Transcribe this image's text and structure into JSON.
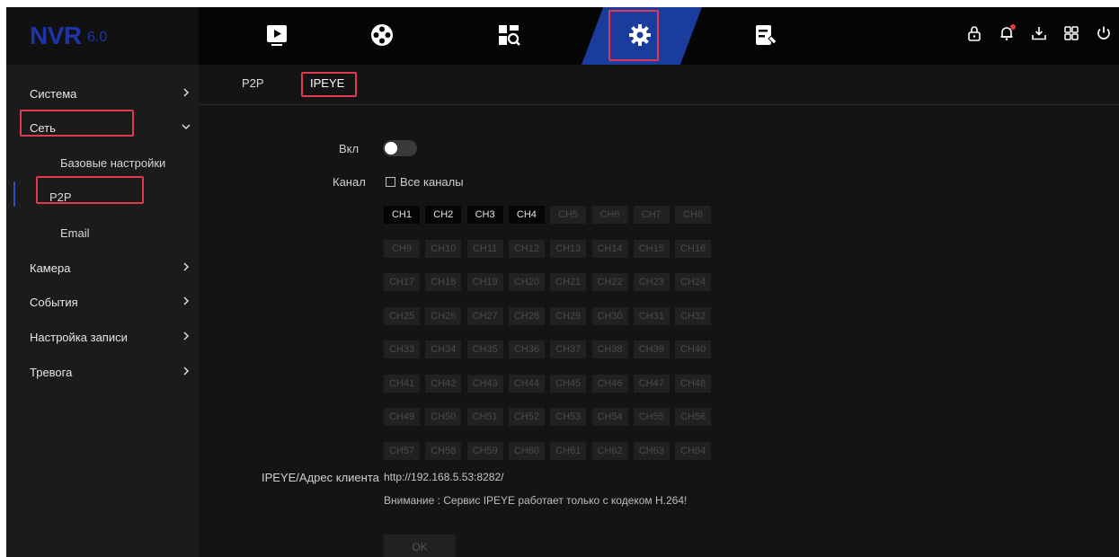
{
  "brand": {
    "name": "NVR",
    "version": "6.0"
  },
  "nav": {
    "icons": [
      {
        "name": "playback-icon"
      },
      {
        "name": "film-reel-icon"
      },
      {
        "name": "search-device-icon"
      },
      {
        "name": "settings-gear-icon"
      },
      {
        "name": "maintenance-icon"
      }
    ],
    "active": "settings-gear-icon"
  },
  "status_icons": [
    "lock-icon",
    "alarm-bell-icon",
    "download-icon",
    "layout-grid-icon",
    "power-icon"
  ],
  "sidebar": {
    "items": [
      {
        "label": "Система",
        "expandable": true
      },
      {
        "label": "Сеть",
        "expandable": true,
        "expanded": true
      },
      {
        "label": "Базовые настройки"
      },
      {
        "label": "P2P"
      },
      {
        "label": "Email"
      },
      {
        "label": "Камера",
        "expandable": true
      },
      {
        "label": "События",
        "expandable": true
      },
      {
        "label": "Настройка записи",
        "expandable": true
      },
      {
        "label": "Тревога",
        "expandable": true
      }
    ]
  },
  "tabs": [
    {
      "label": "P2P"
    },
    {
      "label": "IPEYE"
    }
  ],
  "form": {
    "enable_label": "Вкл",
    "channel_label": "Канал",
    "all_channels_label": "Все каналы",
    "channels": [
      "CH1",
      "CH2",
      "CH3",
      "CH4",
      "CH5",
      "CH6",
      "CH7",
      "CH8",
      "CH9",
      "CH10",
      "CH11",
      "CH12",
      "CH13",
      "CH14",
      "CH15",
      "CH16",
      "CH17",
      "CH18",
      "CH19",
      "CH20",
      "CH21",
      "CH22",
      "CH23",
      "CH24",
      "CH25",
      "CH26",
      "CH27",
      "CH28",
      "CH29",
      "CH30",
      "CH31",
      "CH32",
      "CH33",
      "CH34",
      "CH35",
      "CH36",
      "CH37",
      "CH38",
      "CH39",
      "CH40",
      "CH41",
      "CH42",
      "CH43",
      "CH44",
      "CH45",
      "CH46",
      "CH47",
      "CH48",
      "CH49",
      "CH50",
      "CH51",
      "CH52",
      "CH53",
      "CH54",
      "CH55",
      "CH56",
      "CH57",
      "CH58",
      "CH59",
      "CH60",
      "CH61",
      "CH62",
      "CH63",
      "CH64"
    ],
    "active_channels": 4,
    "client_address_label": "IPEYE/Адрес клиента",
    "client_address": "http://192.168.5.53:8282/",
    "notice": "Внимание : Сервис IPEYE работает только с кодеком H.264!",
    "ok_label": "OK"
  },
  "colors": {
    "accent": "#1a3c9c",
    "highlight": "#e03a52",
    "brand": "#1d35a8"
  }
}
